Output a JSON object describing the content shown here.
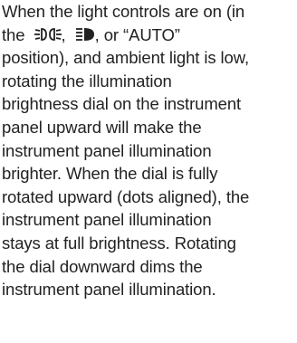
{
  "paragraph": {
    "lines": [
      "When the light controls are on (in",
      "position), and ambient light is low,",
      "rotating the illumination",
      "brightness dial on the instrument",
      "panel upward will make the",
      "instrument panel illumination",
      "brighter. When the dial is fully",
      "rotated upward (dots aligned), the",
      "instrument panel illumination",
      "stays at full brightness. Rotating",
      "the dial downward dims the",
      "instrument panel illumination."
    ],
    "line2_prefix": "the",
    "line2_comma1": ",",
    "line2_comma2": ", or “AUTO”"
  },
  "icons": {
    "parking_light": "parking-light-icon",
    "headlight": "headlight-icon"
  },
  "colors": {
    "text": "#222222",
    "background": "#ffffff"
  }
}
